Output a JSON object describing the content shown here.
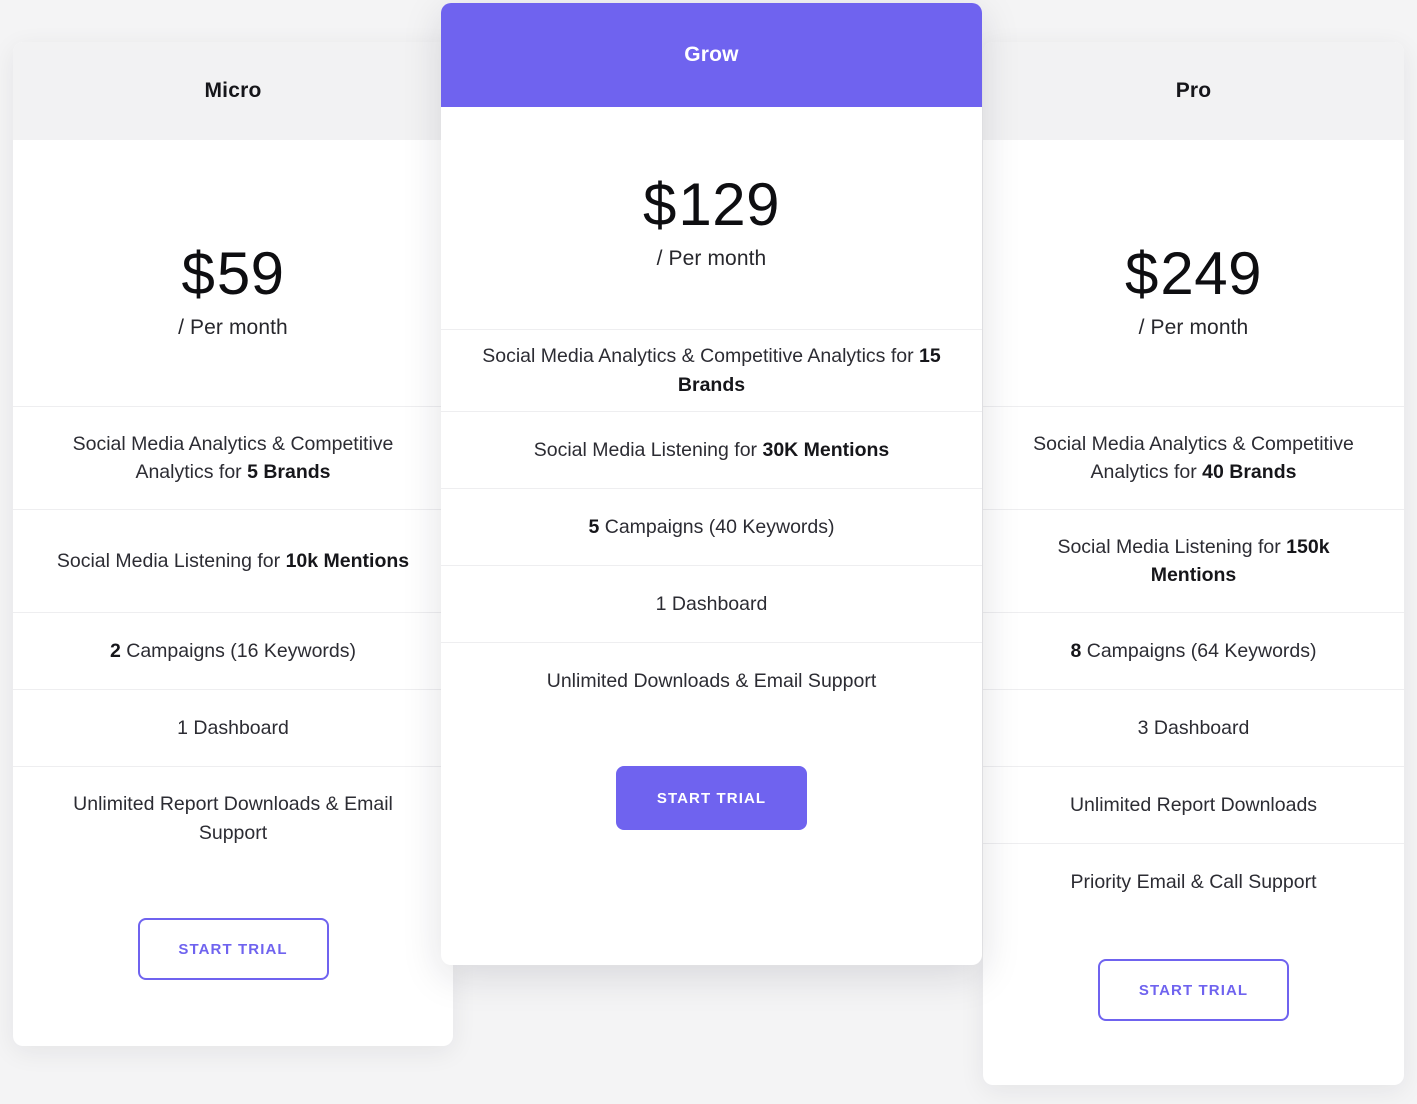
{
  "theme": {
    "accent": "#6f63ef",
    "page_background": "#f4f4f5",
    "card_background": "#ffffff",
    "plain_header_background": "#f2f2f3",
    "divider": "#eeeef0",
    "text": "#2c2c33"
  },
  "plans": {
    "micro": {
      "name": "Micro",
      "featured": false,
      "price": {
        "currency": "$",
        "amount": "59",
        "period": "/ Per month"
      },
      "features": [
        {
          "prefix": "Social Media Analytics & Competitive Analytics for ",
          "strong": "5 Brands",
          "suffix": ""
        },
        {
          "prefix": "Social Media Listening for ",
          "strong": "10k Mentions",
          "suffix": ""
        },
        {
          "prefix": "",
          "strong": "2",
          "suffix": " Campaigns (16 Keywords)"
        },
        {
          "prefix": "1 Dashboard",
          "strong": "",
          "suffix": ""
        },
        {
          "prefix": "Unlimited Report Downloads & Email Support",
          "strong": "",
          "suffix": ""
        }
      ],
      "cta": {
        "label": "Start Trial",
        "style": "outline"
      }
    },
    "grow": {
      "name": "Grow",
      "featured": true,
      "price": {
        "currency": "$",
        "amount": "129",
        "period": "/ Per month"
      },
      "features": [
        {
          "prefix": "Social Media Analytics & Competitive Analytics for ",
          "strong": "15 Brands",
          "suffix": ""
        },
        {
          "prefix": "Social Media Listening for ",
          "strong": "30K Mentions",
          "suffix": ""
        },
        {
          "prefix": "",
          "strong": "5",
          "suffix": " Campaigns (40 Keywords)"
        },
        {
          "prefix": "1 Dashboard",
          "strong": "",
          "suffix": ""
        },
        {
          "prefix": "Unlimited Downloads & Email Support",
          "strong": "",
          "suffix": ""
        }
      ],
      "cta": {
        "label": "Start Trial",
        "style": "solid"
      }
    },
    "pro": {
      "name": "Pro",
      "featured": false,
      "price": {
        "currency": "$",
        "amount": "249",
        "period": "/ Per month"
      },
      "features": [
        {
          "prefix": "Social Media Analytics & Competitive Analytics for ",
          "strong": "40 Brands",
          "suffix": ""
        },
        {
          "prefix": "Social Media Listening for ",
          "strong": "150k Mentions",
          "suffix": ""
        },
        {
          "prefix": "",
          "strong": "8",
          "suffix": " Campaigns (64 Keywords)"
        },
        {
          "prefix": "3 Dashboard",
          "strong": "",
          "suffix": ""
        },
        {
          "prefix": "Unlimited Report Downloads",
          "strong": "",
          "suffix": ""
        },
        {
          "prefix": "Priority Email & Call Support",
          "strong": "",
          "suffix": ""
        }
      ],
      "cta": {
        "label": "Start Trial",
        "style": "outline"
      }
    }
  }
}
